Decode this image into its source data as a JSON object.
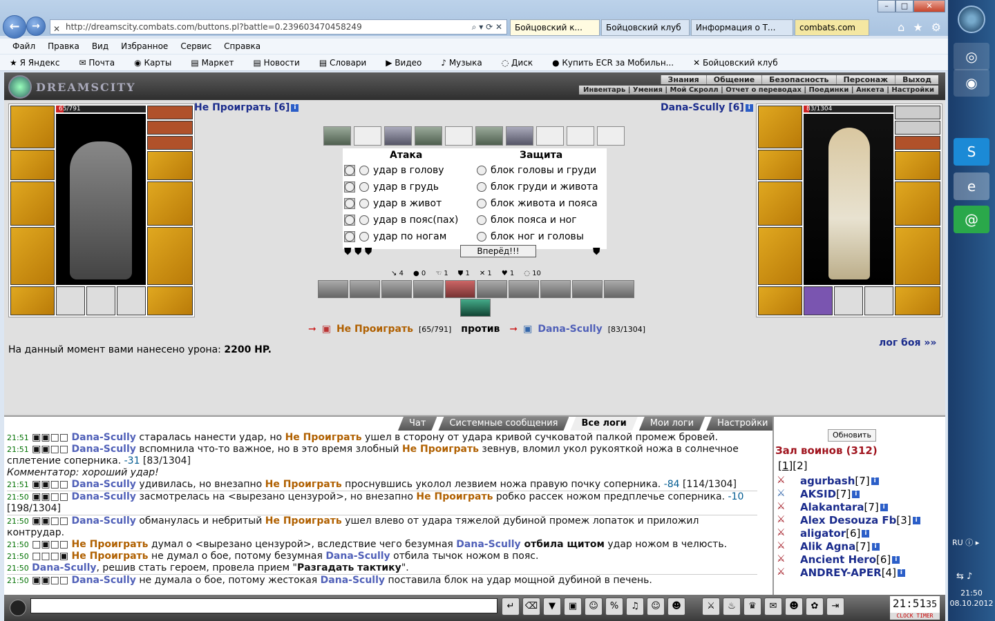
{
  "browser": {
    "url": "http://dreamscity.combats.com/buttons.pl?battle=0.239603470458249",
    "tabs": [
      "Бойцовский к...",
      "Бойцовский клуб",
      "Информация о Т...",
      "combats.com"
    ],
    "menu": [
      "Файл",
      "Правка",
      "Вид",
      "Избранное",
      "Сервис",
      "Справка"
    ],
    "favorites": [
      "Яндекс",
      "Почта",
      "Карты",
      "Маркет",
      "Новости",
      "Словари",
      "Видео",
      "Музыка",
      "Диск",
      "Купить ECR за Мобильн...",
      "Бойцовский клуб"
    ]
  },
  "game": {
    "logo": "DREAMSCITY",
    "top_menu": [
      "Знания",
      "Общение",
      "Безопасность",
      "Персонаж",
      "Выход"
    ],
    "sub_menu": "Инвентарь | Умения | Мой Скролл | Отчет о переводах | Поединки | Анкета | Настройки",
    "player_left": {
      "name": "Не Проиграть [6]",
      "hp_text": "65/791",
      "hp_fraction": 0.082
    },
    "player_right": {
      "name": "Dana-Scully [6]",
      "hp_text": "83/1304",
      "hp_fraction": 0.064
    },
    "attack_title": "Атака",
    "defense_title": "Защита",
    "attacks": [
      "удар в голову",
      "удар в грудь",
      "удар в живот",
      "удар в пояс(пах)",
      "удар по ногам"
    ],
    "blocks": [
      "блок головы и груди",
      "блок груди и живота",
      "блок живота и пояса",
      "блок пояса и ног",
      "блок ног и головы"
    ],
    "go_button": "Вперёд!!!",
    "stats": [
      "4",
      "0",
      "1",
      "1",
      "1",
      "1",
      "10"
    ],
    "vs_left_name": "Не Проиграть",
    "vs_left_hp": "[65/791]",
    "vs_word": "против",
    "vs_right_name": "Dana-Scully",
    "vs_right_hp": "[83/1304]",
    "damage_prefix": "На данный момент вами нанесено урона: ",
    "damage_value": "2200 HP.",
    "log_link": "лог боя »»"
  },
  "log_tabs": [
    "Чат",
    "Системные сообщения",
    "Все логи",
    "Мои логи",
    "Настройки"
  ],
  "log": [
    {
      "time": "21:51",
      "a": "Dana-Scully",
      "text1": " старалась нанести удар, но ",
      "b": "Не Проиграть",
      "text2": " ушел в сторону от удара кривой сучковатой палкой промеж бровей."
    },
    {
      "time": "21:51",
      "a": "Dana-Scully",
      "text1": " вспомнила что-то важное, но в это время злобный ",
      "b": "Не Проиграть",
      "text2": " зевнув, вломил укол рукояткой ножа в солнечное сплетение соперника. ",
      "dmg": "-31",
      "text3": " [83/1304]"
    },
    {
      "comment": "Комментатор: хороший удар!"
    },
    {
      "time": "21:51",
      "a": "Dana-Scully",
      "text1": " удивилась, но внезапно ",
      "b": "Не Проиграть",
      "text2": " проснувшись уколол лезвием ножа правую почку соперника. ",
      "dmg": "-84",
      "text3": " [114/1304]"
    },
    {
      "time": "21:50",
      "a": "Dana-Scully",
      "text1": " засмотрелась на <вырезано цензурой>, но внезапно ",
      "b": "Не Проиграть",
      "text2": " робко рассек ножом предплечье соперника. ",
      "dmg": "-10",
      "text3": " [198/1304]"
    },
    {
      "time": "21:50",
      "a": "Dana-Scully",
      "text1": " обманулась и небритый ",
      "b": "Не Проиграть",
      "text2": " ушел влево от удара тяжелой дубиной промеж лопаток и приложил контрудар."
    },
    {
      "time": "21:50",
      "b": "Не Проиграть",
      "text1": " думал о <вырезано цензурой>, вследствие чего безумная ",
      "a": "Dana-Scully",
      "strong": " отбила щитом",
      "text2": " удар ножом в челюсть."
    },
    {
      "time": "21:50",
      "b": "Не Проиграть",
      "text1": " не думал о бое, потому безумная ",
      "a": "Dana-Scully",
      "text2": " отбила тычок ножом в пояс."
    },
    {
      "time": "21:50",
      "a": "Dana-Scully",
      "text1": ", решив стать героем, провела прием \"",
      "strong": "Разгадать тактику",
      "text2": "\"."
    },
    {
      "time": "21:50",
      "a": "Dana-Scully",
      "text1": " не думала о бое, потому жестокая ",
      "a2": "Dana-Scully",
      "text2": " поставила блок на удар мощной дубиной в печень."
    }
  ],
  "users": {
    "refresh": "Обновить",
    "hall": "Зал воинов (312)",
    "pages": [
      "1",
      "2"
    ],
    "list": [
      {
        "name": "agurbash",
        "level": "[7]"
      },
      {
        "name": "AKSID",
        "level": "[7]"
      },
      {
        "name": "Alakantara",
        "level": "[7]"
      },
      {
        "name": "Alex Desouza Fb",
        "level": "[3]"
      },
      {
        "name": "aligator",
        "level": "[6]"
      },
      {
        "name": "Alik Agna",
        "level": "[7]"
      },
      {
        "name": "Ancient Hero",
        "level": "[6]"
      },
      {
        "name": "ANDREY-APER",
        "level": "[4]"
      }
    ]
  },
  "clock": {
    "time": "21:51",
    "seconds": "35",
    "label": "CLOCK TIMER"
  },
  "taskbar": {
    "lang": "RU",
    "time": "21:50",
    "date": "08.10.2012"
  }
}
